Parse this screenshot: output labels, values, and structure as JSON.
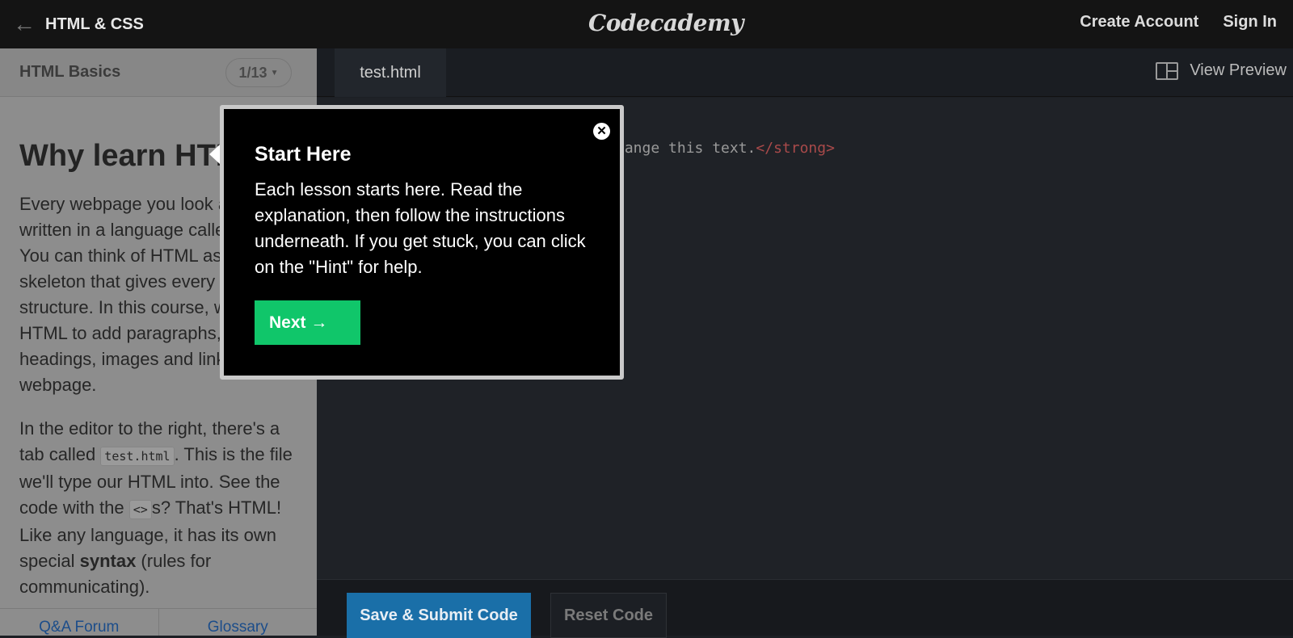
{
  "topbar": {
    "back_icon": "arrow-left-icon",
    "course_title": "HTML & CSS",
    "logo": "Codecademy",
    "create_account": "Create Account",
    "sign_in": "Sign In"
  },
  "lesson": {
    "name": "HTML Basics",
    "progress": "1/13",
    "heading": "Why learn HTML?",
    "para1": "Every webpage you look at is written in a language called HTML. You can think of HTML as the skeleton that gives every webpage structure. In this course, we'll use HTML to add paragraphs, headings, images and links to a webpage.",
    "para2_a": "In the editor to the right, there's a tab called ",
    "para2_code1": "test.html",
    "para2_b": ". This is the file we'll type our HTML into. See the code with the ",
    "para2_code2": "<>",
    "para2_c": "s? That's HTML! Like any language, it has its own special ",
    "para2_bold": "syntax",
    "para2_d": " (rules for communicating).",
    "footer_forum": "Q&A Forum",
    "footer_glossary": "Glossary"
  },
  "editor": {
    "file_tab": "test.html",
    "view_preview": "View Preview",
    "code_text": "hange this text.",
    "code_close_tag": "</strong>",
    "submit": "Save & Submit Code",
    "reset": "Reset Code"
  },
  "popup": {
    "close_icon": "close-icon",
    "close_glyph": "✕",
    "title": "Start Here",
    "text": "Each lesson starts here. Read the explanation, then follow the instructions underneath. If you get stuck, you can click on the \"Hint\" for help.",
    "next": "Next →"
  },
  "colors": {
    "accent_green": "#10c66a",
    "submit_blue": "#1a6fa8"
  }
}
